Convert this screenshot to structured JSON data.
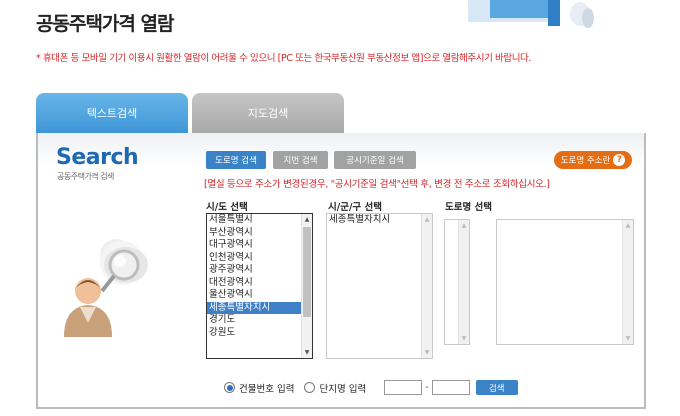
{
  "page": {
    "title": "공동주택가격 열람",
    "notice": "* 휴대폰 등 모바일 기기 이용시 원활한 열람이 어려울 수 있으니 [PC 또는 한국부동산원 부동산정보 앱]으로 열람해주시기 바랍니다."
  },
  "tabs": [
    {
      "label": "텍스트검색",
      "active": true
    },
    {
      "label": "지도검색",
      "active": false
    }
  ],
  "search": {
    "logo": "Search",
    "subtitle": "공동주택가격 검색",
    "buttons": {
      "road": "도로명 검색",
      "lot": "지번 검색",
      "base": "공시기준일 검색",
      "road_lookup": "도로명 주소란"
    },
    "help_text": "[멸실 등으로 주소가 변경된경우, \"공시기준일 검색\"선택 후, 변경 전 주소로 조회하십시오.]",
    "labels": {
      "sido": "시/도 선택",
      "sigungu": "시/군/구 선택",
      "road": "도로명 선택"
    },
    "sido_options": [
      "서울특별시",
      "부산광역시",
      "대구광역시",
      "인천광역시",
      "광주광역시",
      "대전광역시",
      "울산광역시",
      "세종특별자치시",
      "경기도",
      "강원도"
    ],
    "sido_selected": "세종특별자치시",
    "sigungu_options": [
      "세종특별자치시"
    ],
    "radio": {
      "building": "건물번호 입력",
      "complex": "단지명 입력",
      "selected": "building"
    },
    "input_main": "",
    "input_sub": "",
    "search_button": "검색"
  },
  "colors": {
    "accent_blue": "#3b83c7",
    "notice_red": "#d6262a",
    "orange": "#e46d14"
  }
}
